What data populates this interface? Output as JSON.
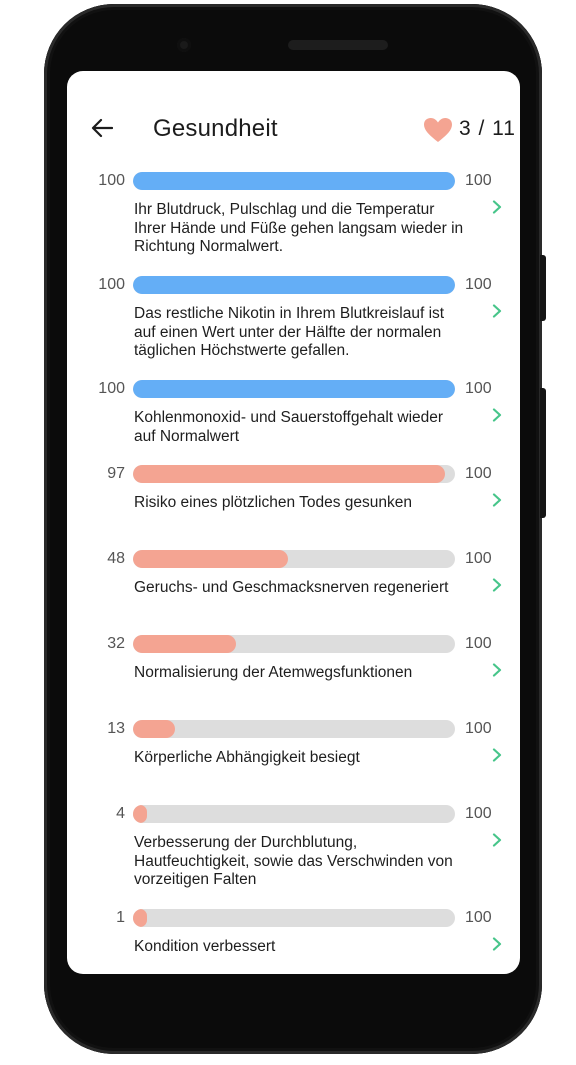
{
  "header": {
    "title": "Gesundheit",
    "counter": "3 / 11"
  },
  "colors": {
    "complete": "#64aef6",
    "progress": "#f4a492",
    "track": "#dddddd",
    "chevron": "#47c58a",
    "heart": "#f4a492"
  },
  "items": [
    {
      "value": 100,
      "max": 100,
      "status": "complete",
      "description": "Ihr Blutdruck, Pulschlag und die Temperatur Ihrer Hände und Füße gehen langsam wieder in Richtung Normalwert."
    },
    {
      "value": 100,
      "max": 100,
      "status": "complete",
      "description": "Das restliche Nikotin in Ihrem Blutkreislauf ist auf einen Wert unter der Hälfte der normalen täglichen Höchstwerte gefallen."
    },
    {
      "value": 100,
      "max": 100,
      "status": "complete",
      "description": "Kohlenmonoxid- und Sauerstoffgehalt wieder auf Normalwert"
    },
    {
      "value": 97,
      "max": 100,
      "status": "progress",
      "description": "Risiko eines plötzlichen Todes gesunken"
    },
    {
      "value": 48,
      "max": 100,
      "status": "progress",
      "description": "Geruchs- und Geschmacksnerven regeneriert"
    },
    {
      "value": 32,
      "max": 100,
      "status": "progress",
      "description": "Normalisierung der Atemwegsfunktionen"
    },
    {
      "value": 13,
      "max": 100,
      "status": "progress",
      "description": "Körperliche Abhängigkeit besiegt"
    },
    {
      "value": 4,
      "max": 100,
      "status": "progress",
      "description": "Verbesserung der Durchblutung, Hautfeuchtigkeit, sowie das Verschwinden von vorzeitigen Falten"
    },
    {
      "value": 1,
      "max": 100,
      "status": "progress",
      "description": "Kondition verbessert"
    }
  ]
}
